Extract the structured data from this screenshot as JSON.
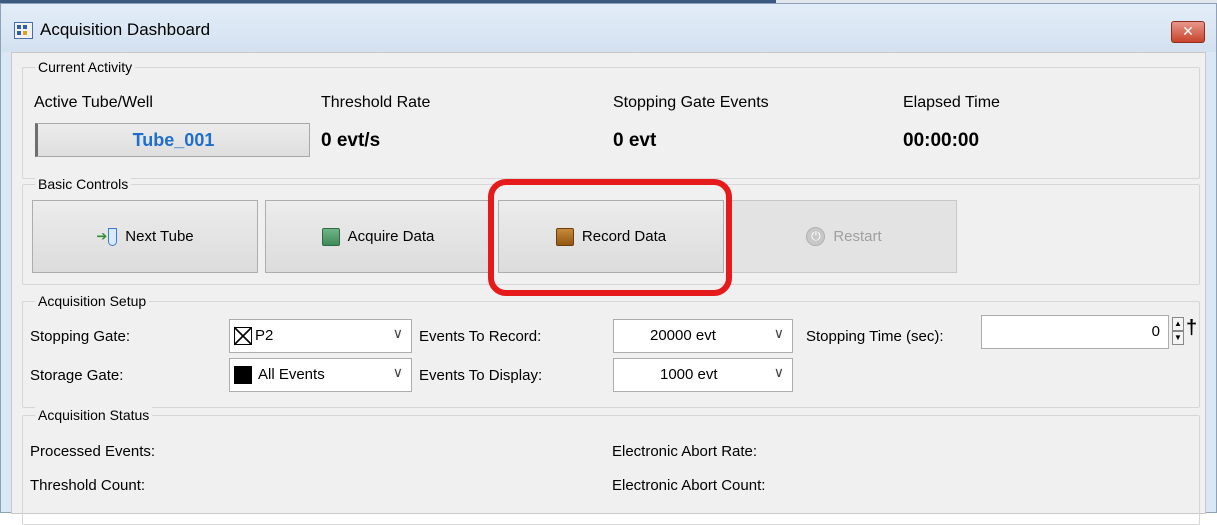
{
  "window": {
    "title": "Acquisition Dashboard",
    "close_glyph": "✕"
  },
  "current_activity": {
    "legend": "Current Activity",
    "active_tube_label": "Active Tube/Well",
    "active_tube_value": "Tube_001",
    "threshold_rate_label": "Threshold Rate",
    "threshold_rate_value": "0 evt/s",
    "stopping_gate_events_label": "Stopping Gate Events",
    "stopping_gate_events_value": "0 evt",
    "elapsed_time_label": "Elapsed Time",
    "elapsed_time_value": "00:00:00"
  },
  "basic_controls": {
    "legend": "Basic Controls",
    "next_tube": "Next Tube",
    "acquire_data": "Acquire Data",
    "record_data": "Record Data",
    "restart": "Restart",
    "colors": {
      "acquire": "#4f9a6a",
      "record": "#a86412",
      "highlight": "#e61a1a"
    }
  },
  "acquisition_setup": {
    "legend": "Acquisition Setup",
    "stopping_gate_label": "Stopping Gate:",
    "stopping_gate_value": "P2",
    "storage_gate_label": "Storage Gate:",
    "storage_gate_value": "All Events",
    "events_to_record_label": "Events To Record:",
    "events_to_record_value": "20000 evt",
    "events_to_display_label": "Events To Display:",
    "events_to_display_value": "1000 evt",
    "stopping_time_label": "Stopping Time (sec):",
    "stopping_time_value": "0"
  },
  "acquisition_status": {
    "legend": "Acquisition Status",
    "processed_events_label": "Processed Events:",
    "threshold_count_label": "Threshold Count:",
    "electronic_abort_rate_label": "Electronic Abort Rate:",
    "electronic_abort_count_label": "Electronic Abort Count:"
  }
}
